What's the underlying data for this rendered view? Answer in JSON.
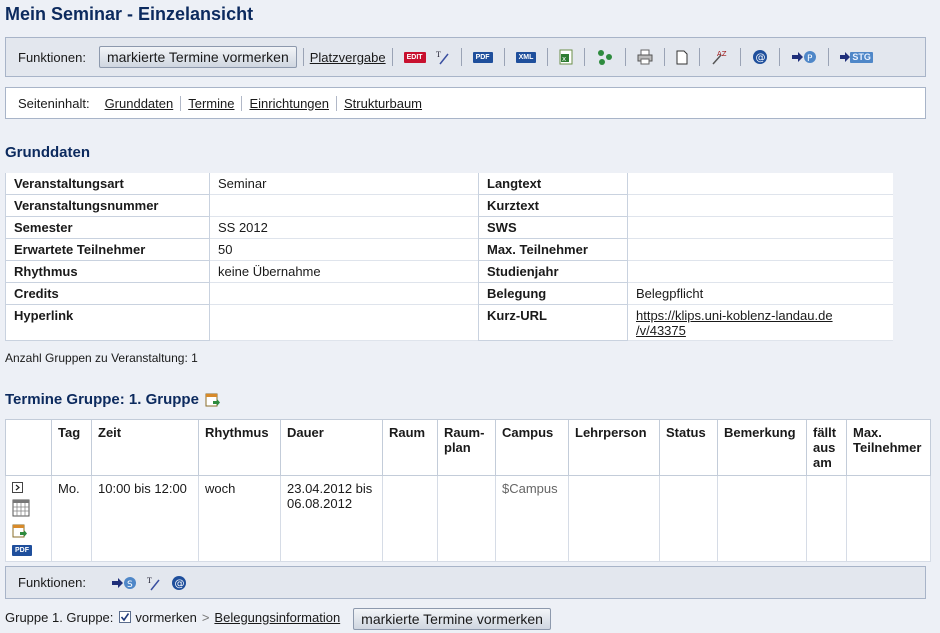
{
  "page": {
    "title": "Mein Seminar - Einzelansicht"
  },
  "toolbar": {
    "label": "Funktionen:",
    "mark_button": "markierte Termine vormerken",
    "platzvergabe": "Platzvergabe",
    "edit_badge": "EDIT",
    "pdf_badge": "PDF",
    "xml_badge": "XML",
    "stg_badge": "STG"
  },
  "seiteninhalt": {
    "label": "Seiteninhalt:",
    "links": [
      "Grunddaten",
      "Termine",
      "Einrichtungen",
      "Strukturbaum"
    ]
  },
  "grunddaten": {
    "heading": "Grunddaten",
    "rows": [
      {
        "k1": "Veranstaltungsart",
        "v1": "Seminar",
        "k2": "Langtext",
        "v2": ""
      },
      {
        "k1": "Veranstaltungsnummer",
        "v1": "",
        "k2": "Kurztext",
        "v2": ""
      },
      {
        "k1": "Semester",
        "v1": "SS 2012",
        "k2": "SWS",
        "v2": ""
      },
      {
        "k1": "Erwartete Teilnehmer",
        "v1": "50",
        "k2": "Max. Teilnehmer",
        "v2": ""
      },
      {
        "k1": "Rhythmus",
        "v1": "keine Übernahme",
        "k2": "Studienjahr",
        "v2": ""
      },
      {
        "k1": "Credits",
        "v1": "",
        "k2": "Belegung",
        "v2": "Belegpflicht"
      },
      {
        "k1": "Hyperlink",
        "v1": "",
        "k2": "Kurz-URL",
        "v2": "https://klips.uni-koblenz-landau.de/v/43375"
      }
    ],
    "kurz_url_line1": "https://klips.uni-koblenz-landau.de",
    "kurz_url_line2": "/v/43375",
    "anzahl": "Anzahl Gruppen zu Veranstaltung: 1"
  },
  "termine": {
    "heading": "Termine Gruppe: 1. Gruppe",
    "headers": {
      "tag": "Tag",
      "zeit": "Zeit",
      "rhythmus": "Rhythmus",
      "dauer": "Dauer",
      "raum": "Raum",
      "raumplan_1": "Raum-",
      "raumplan_2": "plan",
      "campus": "Campus",
      "lehrperson": "Lehrperson",
      "status": "Status",
      "bemerkung": "Bemerkung",
      "faellt_1": "fällt",
      "faellt_2": "aus",
      "faellt_3": "am",
      "max_1": "Max.",
      "max_2": "Teilnehmer"
    },
    "row": {
      "tag": "Mo.",
      "zeit": "10:00 bis 12:00",
      "rhythmus": "woch",
      "dauer_1": "23.04.2012 bis",
      "dauer_2": "06.08.2012",
      "raum": "",
      "raumplan": "",
      "campus": "$Campus",
      "lehrperson": "",
      "status": "",
      "bemerkung": "",
      "faellt": "",
      "max": "",
      "pdf_badge": "PDF"
    }
  },
  "bottom_toolbar": {
    "label": "Funktionen:"
  },
  "gruppe_line": {
    "label": "Gruppe 1. Gruppe:",
    "vormerken": "vormerken",
    "arrow": ">",
    "belegungsinfo": "Belegungsinformation",
    "button": "markierte Termine vormerken"
  }
}
